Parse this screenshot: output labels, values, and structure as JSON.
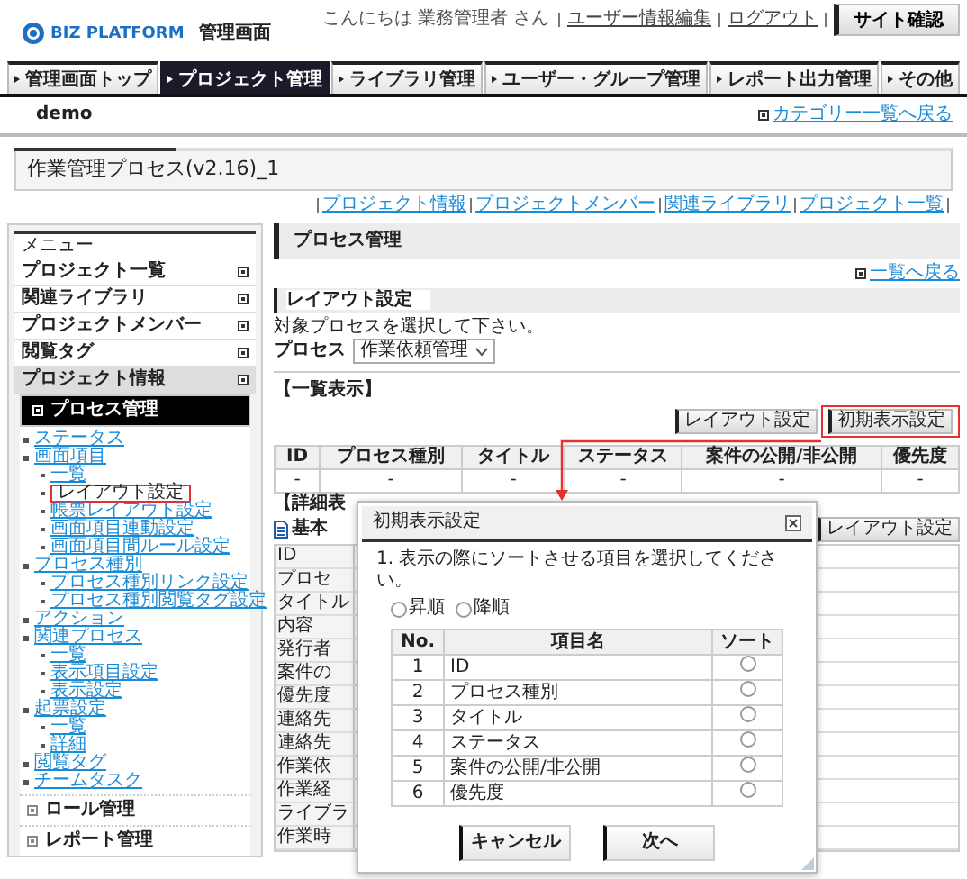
{
  "header": {
    "logo_text": "BIZ PLATFORM",
    "subtitle": "管理画面",
    "greeting": [
      "こんにちは",
      "業務管理者",
      "さん"
    ],
    "user_links": [
      "ユーザー情報編集",
      "ログアウト"
    ],
    "site_button": "サイト確認"
  },
  "nav_tabs": [
    {
      "label": "管理画面トップ",
      "selected": false
    },
    {
      "label": "プロジェクト管理",
      "selected": true
    },
    {
      "label": "ライブラリ管理",
      "selected": false
    },
    {
      "label": "ユーザー・グループ管理",
      "selected": false
    },
    {
      "label": "レポート出力管理",
      "selected": false
    },
    {
      "label": "その他",
      "selected": false
    }
  ],
  "site_bar": {
    "site": "demo",
    "back_link": "カテゴリー一覧へ戻る"
  },
  "page_title": "作業管理プロセス(v2.16)_1",
  "project_links": [
    "プロジェクト情報",
    "プロジェクトメンバー",
    "関連ライブラリ",
    "プロジェクト一覧"
  ],
  "sidebar": {
    "title": "メニュー",
    "items": [
      {
        "label": "プロジェクト一覧",
        "expanded": false
      },
      {
        "label": "関連ライブラリ",
        "expanded": false
      },
      {
        "label": "プロジェクトメンバー",
        "expanded": false
      },
      {
        "label": "閲覧タグ",
        "expanded": false
      },
      {
        "label": "プロジェクト情報",
        "expanded": true
      }
    ],
    "submenu": {
      "label": "プロセス管理",
      "selected": true
    },
    "tree": [
      {
        "label": "ステータス",
        "selected": false
      },
      {
        "label": "画面項目",
        "selected": false,
        "children": [
          {
            "label": "一覧",
            "selected": false
          },
          {
            "label": "レイアウト設定",
            "selected": true
          },
          {
            "label": "帳票レイアウト設定",
            "selected": false
          },
          {
            "label": "画面項目連動設定",
            "selected": false
          },
          {
            "label": "画面項目間ルール設定",
            "selected": false
          }
        ]
      },
      {
        "label": "プロセス種別",
        "selected": false,
        "children": [
          {
            "label": "プロセス種別リンク設定",
            "selected": false
          },
          {
            "label": "プロセス種別閲覧タグ設定",
            "selected": false
          }
        ]
      },
      {
        "label": "アクション",
        "selected": false
      },
      {
        "label": "関連プロセス",
        "selected": false,
        "children": [
          {
            "label": "一覧",
            "selected": false
          },
          {
            "label": "表示項目設定",
            "selected": false
          },
          {
            "label": "表示設定",
            "selected": false
          }
        ]
      },
      {
        "label": "起票設定",
        "selected": false,
        "children": [
          {
            "label": "一覧",
            "selected": false
          },
          {
            "label": "詳細",
            "selected": false
          }
        ]
      },
      {
        "label": "閲覧タグ",
        "selected": false
      },
      {
        "label": "チームタスク",
        "selected": false
      }
    ],
    "footer_items": [
      "ロール管理",
      "レポート管理"
    ]
  },
  "content": {
    "panel_title": "プロセス管理",
    "back_link": "一覧へ戻る",
    "layout_section": {
      "title": "レイアウト設定",
      "instruction": "対象プロセスを選択して下さい。",
      "process_label": "プロセス",
      "process_value": "作業依頼管理"
    },
    "list_view": {
      "title": "【一覧表示】",
      "buttons": [
        {
          "label": "レイアウト設定",
          "highlighted": false
        },
        {
          "label": "初期表示設定",
          "highlighted": true
        }
      ],
      "columns": [
        "ID",
        "プロセス種別",
        "タイトル",
        "ステータス",
        "案件の公開/非公開",
        "優先度"
      ],
      "rows": [
        [
          "-",
          "-",
          "-",
          "-",
          "-",
          "-"
        ]
      ]
    },
    "detail_view": {
      "title": "【詳細表",
      "tab": "基本",
      "button": "レイアウト設定",
      "row_labels": [
        "ID",
        "プロセ",
        "タイトル",
        "内容",
        "発行者",
        "案件の",
        "優先度",
        "連絡先",
        "連絡先",
        "作業依",
        "作業経",
        "ライブラ",
        "作業時"
      ]
    }
  },
  "dialog": {
    "title": "初期表示設定",
    "instruction": "1. 表示の際にソートさせる項目を選択してください。",
    "order_options": [
      {
        "label": "昇順",
        "selected": false
      },
      {
        "label": "降順",
        "selected": false
      }
    ],
    "columns": [
      "No.",
      "項目名",
      "ソート"
    ],
    "rows": [
      {
        "no": "1",
        "name": "ID",
        "selected": false
      },
      {
        "no": "2",
        "name": "プロセス種別",
        "selected": false
      },
      {
        "no": "3",
        "name": "タイトル",
        "selected": false
      },
      {
        "no": "4",
        "name": "ステータス",
        "selected": false
      },
      {
        "no": "5",
        "name": "案件の公開/非公開",
        "selected": false
      },
      {
        "no": "6",
        "name": "優先度",
        "selected": false
      }
    ],
    "buttons": [
      "キャンセル",
      "次へ"
    ]
  }
}
